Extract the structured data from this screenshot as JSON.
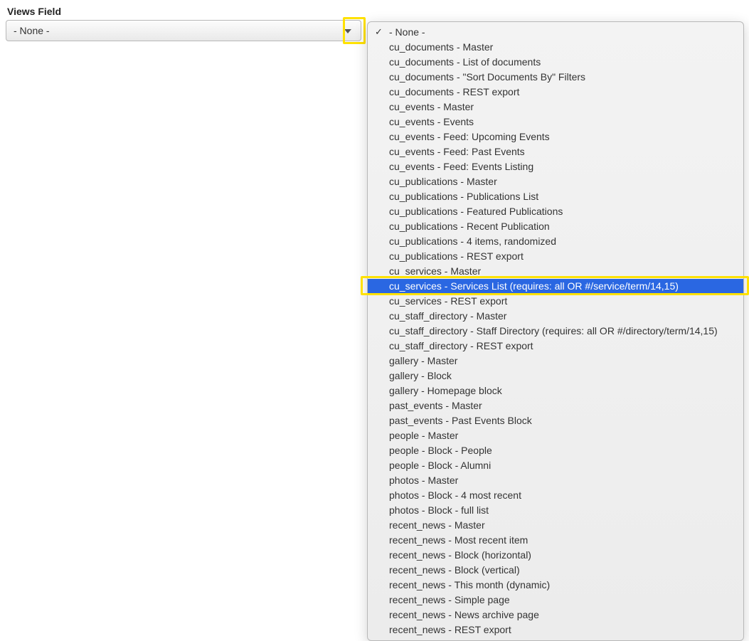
{
  "field_label": "Views Field",
  "select": {
    "value": "- None -"
  },
  "dropdown": {
    "checked_index": 0,
    "selected_index": 18,
    "highlighted_index": 18,
    "options": [
      "- None -",
      "cu_documents - Master",
      "cu_documents - List of documents",
      "cu_documents - \"Sort Documents By\" Filters",
      "cu_documents - REST export",
      "cu_events - Master",
      "cu_events - Events",
      "cu_events - Feed: Upcoming Events",
      "cu_events - Feed: Past Events",
      "cu_events - Feed: Events Listing",
      "cu_publications - Master",
      "cu_publications - Publications List",
      "cu_publications - Featured Publications",
      "cu_publications - Recent Publication",
      "cu_publications - 4 items, randomized",
      "cu_publications - REST export",
      "cu_services - Master",
      "cu_services - Services List (requires: all OR #/service/term/14,15)",
      "cu_services - REST export",
      "cu_staff_directory - Master",
      "cu_staff_directory - Staff Directory (requires: all OR #/directory/term/14,15)",
      "cu_staff_directory - REST export",
      "gallery - Master",
      "gallery - Block",
      "gallery - Homepage block",
      "past_events - Master",
      "past_events - Past Events Block",
      "people - Master",
      "people - Block - People",
      "people - Block - Alumni",
      "photos - Master",
      "photos - Block - 4 most recent",
      "photos - Block - full list",
      "recent_news - Master",
      "recent_news - Most recent item",
      "recent_news - Block (horizontal)",
      "recent_news - Block (vertical)",
      "recent_news - This month (dynamic)",
      "recent_news - Simple page",
      "recent_news - News archive page",
      "recent_news - REST export"
    ]
  }
}
